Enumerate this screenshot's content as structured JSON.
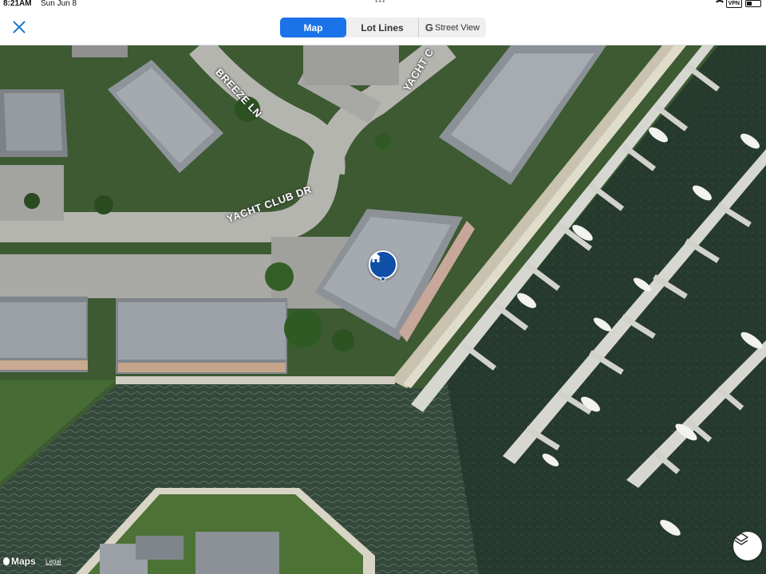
{
  "status_bar": {
    "time": "8:21AM",
    "date": "Sun Jun 8",
    "dots": "•••",
    "vpn": "VPN"
  },
  "toolbar": {
    "tabs": [
      {
        "label": "Map",
        "selected": true
      },
      {
        "label": "Lot Lines",
        "selected": false
      },
      {
        "label": "Street View",
        "selected": false,
        "icon": "google-g-icon"
      }
    ],
    "street_view_g": "G"
  },
  "map": {
    "road_labels": {
      "breeze": "BREEZE LN",
      "yacht_top": "YACHT C",
      "yacht_dr": "YACHT CLUB DR"
    },
    "pin_icon": "home-icon",
    "attribution": "Maps",
    "legal": "Legal",
    "colors": {
      "pin": "#0f4fa8",
      "accent": "#1a73e8",
      "water": "#2c4236",
      "grass": "#3f6a2f",
      "road": "#b8b8b8"
    }
  }
}
